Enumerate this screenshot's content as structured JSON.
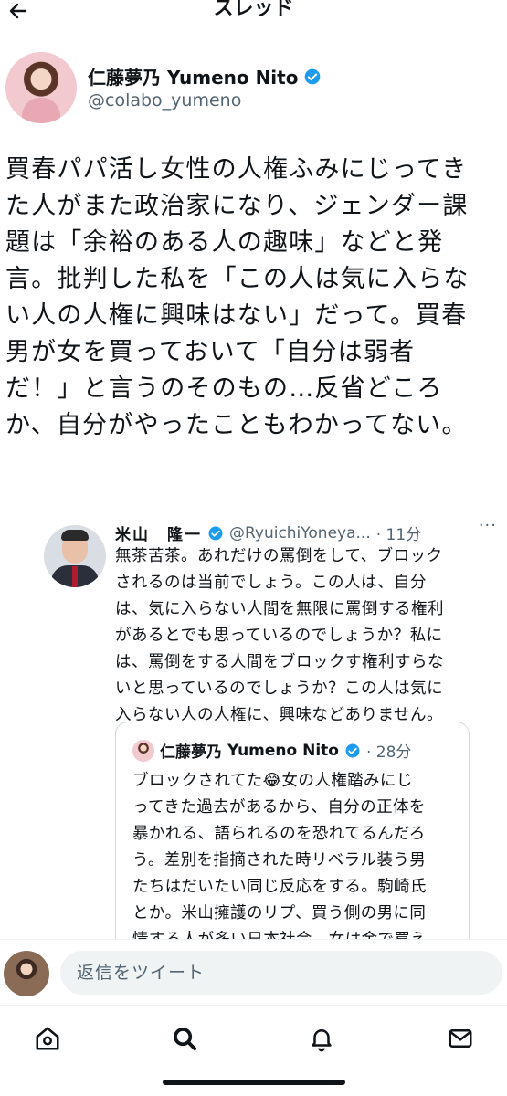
{
  "header": {
    "title": "スレッド",
    "back_icon": "arrow-left-icon"
  },
  "tweet": {
    "author_name": "仁藤夢乃 Yumeno Nito",
    "author_handle": "@colabo_yumeno",
    "text": "買春パパ活し女性の人権ふみにじってき\nた人がまた政治家になり、ジェンダー課\n題は「余裕のある人の趣味」などと発\n言。批判した私を「この人は気に入らな\nい人の人権に興味はない」だって。買春\n男が女を買っておいて「自分は弱者\nだ！」と言うのそのもの…反省どころ\nか、自分がやったこともわかってない。"
  },
  "quoted": {
    "author_name": "米山　隆一",
    "author_handle": "@RyuichiYoneya...",
    "time": "· 11分",
    "more": "···",
    "text": "無茶苦茶。あれだけの罵倒をして、ブロック\nされるのは当前でしょう。この人は、自分\nは、気に入らない人間を無限に罵倒する権利\nがあるとでも思っているのでしょうか？私に\nは、罵倒をする人間をブロックす権利すらな\nいと思っているのでしょうか？この人は気に\n入らない人の人権に、興味などありません。"
  },
  "inner_quote": {
    "author_name": "仁藤夢乃",
    "author_name_en": "Yumeno Nito",
    "time": "· 28分",
    "text": "ブロックされてた😂女の人権踏みにじ\nってきた過去があるから、自分の正体を\n暴かれる、語られるのを恐れてるんだろ\nう。差別を指摘された時リベラル装う男\nたちはだいたい同じ反応をする。駒崎氏\nとか。米山擁護のリプ、買う側の男に同\n情する人が多い日本社会。女は金で買え"
  },
  "reply_bar": {
    "placeholder": "返信をツイート"
  },
  "nav": {
    "items": [
      "home-icon",
      "search-icon",
      "bell-icon",
      "mail-icon"
    ]
  },
  "colors": {
    "verified": "#1d9bf0",
    "text": "#0f1419",
    "secondary": "#536471"
  }
}
